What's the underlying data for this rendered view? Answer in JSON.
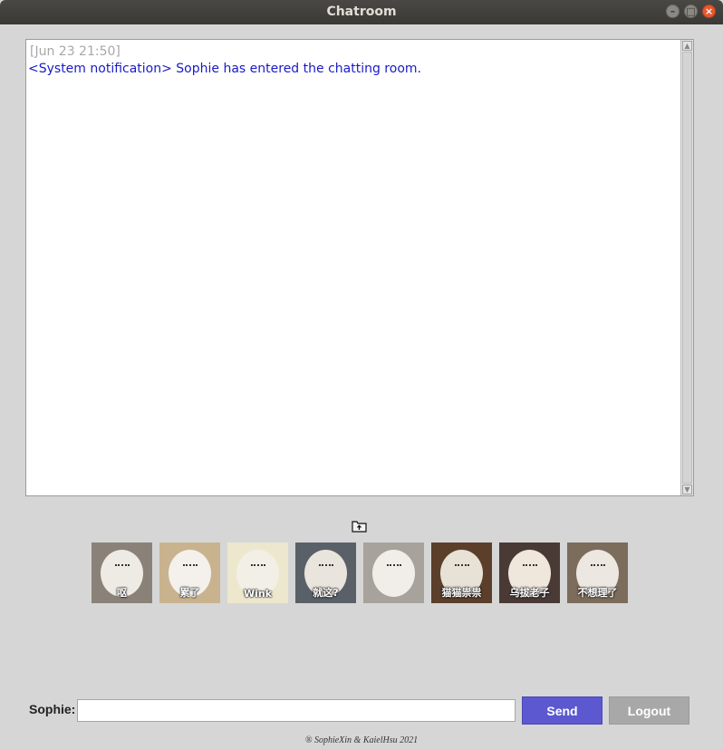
{
  "window": {
    "title": "Chatroom",
    "controls": {
      "minimize": "–",
      "maximize": "□",
      "close": "×"
    }
  },
  "chat": {
    "timestamp": "[Jun 23 21:50]",
    "messages": [
      "<System notification> Sophie has entered the chatting room."
    ]
  },
  "file_button": {
    "icon": "folder-upload-icon"
  },
  "stickers": [
    {
      "caption": "呕",
      "bg": "#8a8178",
      "cat": "#eeeae4"
    },
    {
      "caption": "累了",
      "bg": "#c9b38e",
      "cat": "#f4f1ec"
    },
    {
      "caption": "Wink",
      "bg": "#ede8cd",
      "cat": "#f2efe6"
    },
    {
      "caption": "就这?",
      "bg": "#5a6068",
      "cat": "#e9e4dc"
    },
    {
      "caption": "",
      "bg": "#a7a39c",
      "cat": "#f1eee9"
    },
    {
      "caption": "猫猫祟祟",
      "bg": "#5b3f2b",
      "cat": "#e8e1d6"
    },
    {
      "caption": "乌拔老子",
      "bg": "#4a3a35",
      "cat": "#efe6dc"
    },
    {
      "caption": "不想理了",
      "bg": "#7c6c5c",
      "cat": "#ece7e0"
    }
  ],
  "input": {
    "label": "Sophie:",
    "value": "",
    "placeholder": ""
  },
  "buttons": {
    "send": "Send",
    "logout": "Logout"
  },
  "colors": {
    "system_message": "#1a1ac8",
    "timestamp": "#a8a8a8",
    "send_button": "#5b58d0",
    "logout_button": "#a8a8a8"
  },
  "footer": "® SophieXin & KaielHsu 2021"
}
